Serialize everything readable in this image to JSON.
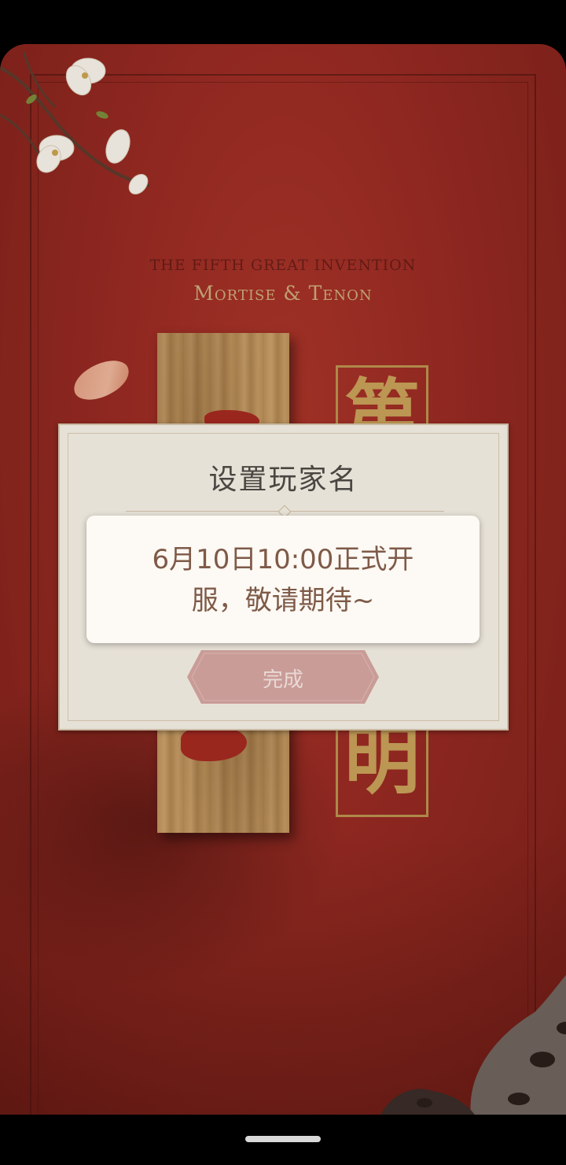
{
  "brand": {
    "subtitle_small": "THE FIFTH GREAT INVENTION",
    "subtitle_large": "Mortise & Tenon",
    "callig_top": "第",
    "callig_bottom": "明"
  },
  "dialog": {
    "title": "设置玩家名",
    "confirm_label": "完成"
  },
  "toast": {
    "line1": "6月10日10:00正式开",
    "line2": "服，敬请期待~"
  },
  "icons": {
    "decor_top_left": "magnolia-branch-icon",
    "decor_bottom_right": "scholar-rock-icon",
    "decor_petal": "petal-icon"
  },
  "colors": {
    "background": "#952a22",
    "gold": "#c79f58",
    "dialog_bg": "#e6e1d6",
    "toast_text": "#7e5a48",
    "button": "#c99c98"
  }
}
